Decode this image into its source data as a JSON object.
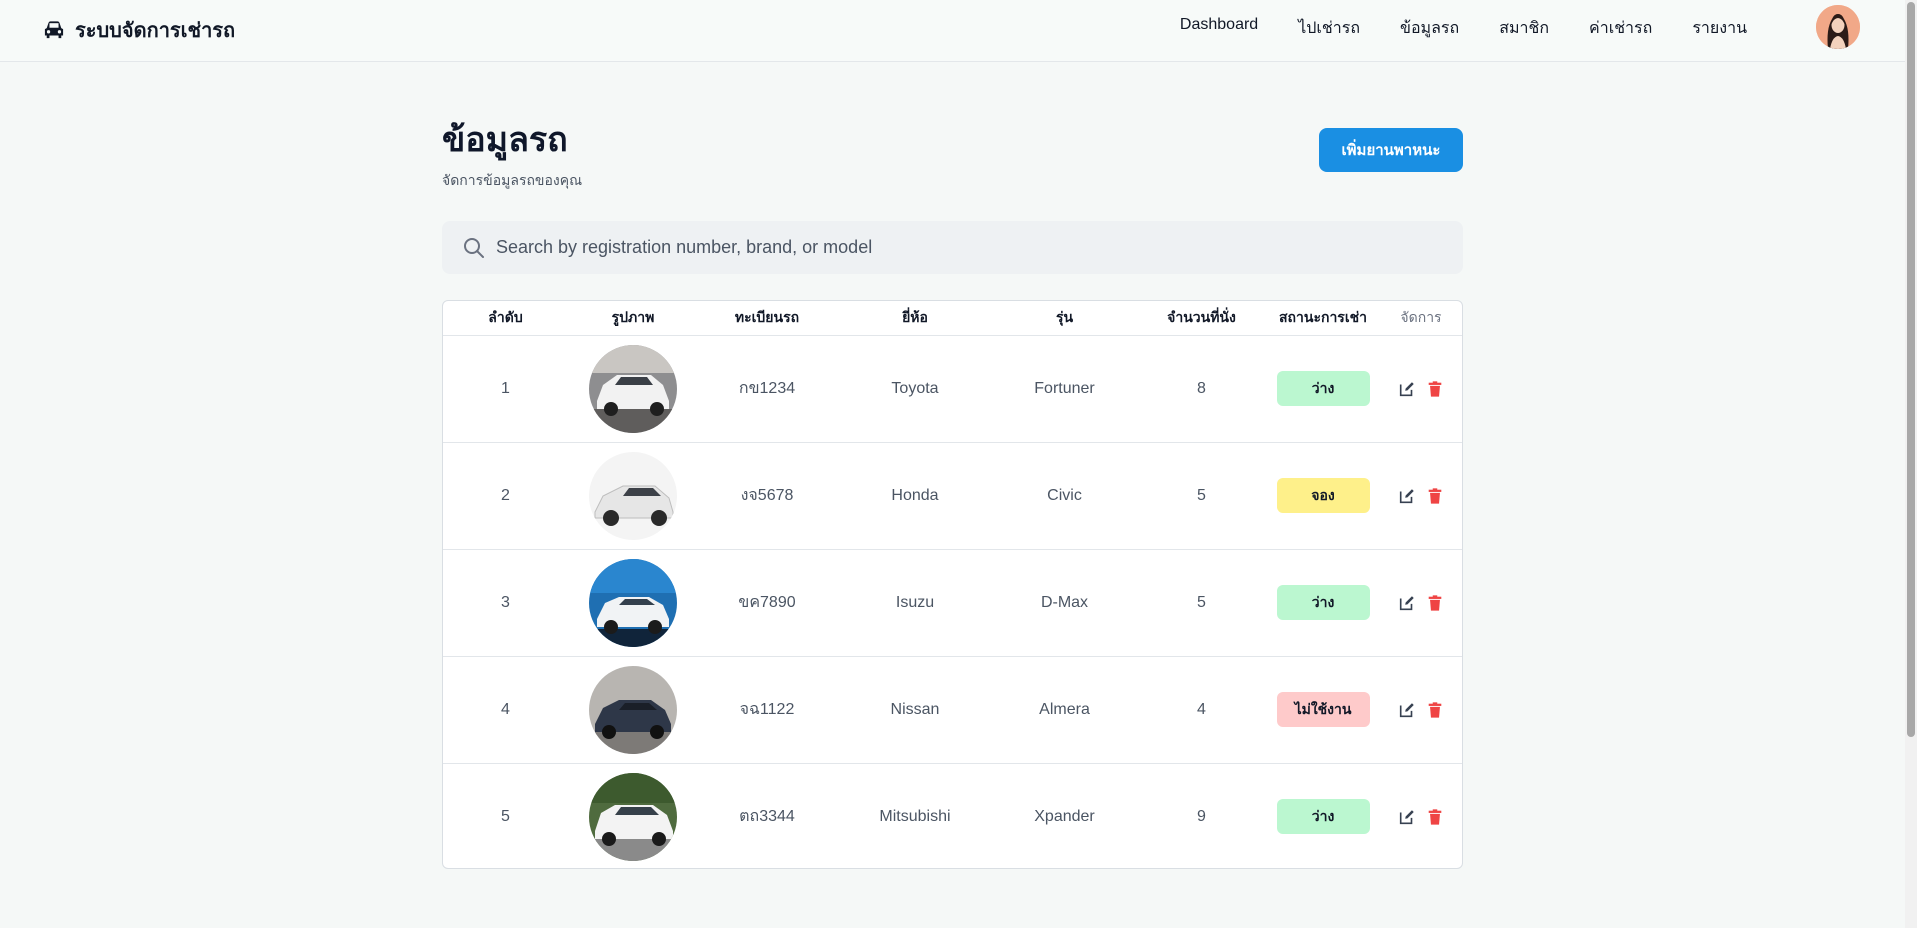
{
  "header": {
    "brand": "ระบบจัดการเช่ารถ",
    "nav": [
      "Dashboard",
      "ไปเช่ารถ",
      "ข้อมูลรถ",
      "สมาชิก",
      "ค่าเช่ารถ",
      "รายงาน"
    ]
  },
  "page": {
    "title": "ข้อมูลรถ",
    "subtitle": "จัดการข้อมูลรถของคุณ",
    "add_button": "เพิ่มยานพาหนะ"
  },
  "search": {
    "placeholder": "Search by registration number, brand, or model"
  },
  "table": {
    "headers": [
      "ลำดับ",
      "รูปภาพ",
      "ทะเบียนรถ",
      "ยี่ห้อ",
      "รุ่น",
      "จำนวนที่นั่ง",
      "สถานะการเช่า",
      "จัดการ"
    ],
    "rows": [
      {
        "no": "1",
        "plate": "กข1234",
        "brand": "Toyota",
        "model": "Fortuner",
        "seats": "8",
        "status": "ว่าง",
        "status_kind": "free"
      },
      {
        "no": "2",
        "plate": "งจ5678",
        "brand": "Honda",
        "model": "Civic",
        "seats": "5",
        "status": "จอง",
        "status_kind": "booked"
      },
      {
        "no": "3",
        "plate": "ขค7890",
        "brand": "Isuzu",
        "model": "D-Max",
        "seats": "5",
        "status": "ว่าง",
        "status_kind": "free"
      },
      {
        "no": "4",
        "plate": "จฉ1122",
        "brand": "Nissan",
        "model": "Almera",
        "seats": "4",
        "status": "ไม่ใช้งาน",
        "status_kind": "inactive"
      },
      {
        "no": "5",
        "plate": "ตถ3344",
        "brand": "Mitsubishi",
        "model": "Xpander",
        "seats": "9",
        "status": "ว่าง",
        "status_kind": "free"
      }
    ]
  },
  "colors": {
    "primary": "#1a8fe3",
    "status_free": "#bbf7d0",
    "status_booked": "#fef08a",
    "status_inactive": "#fecaca",
    "delete": "#ef4444"
  },
  "icons": [
    "car-icon",
    "search-icon",
    "edit-icon",
    "trash-icon"
  ]
}
